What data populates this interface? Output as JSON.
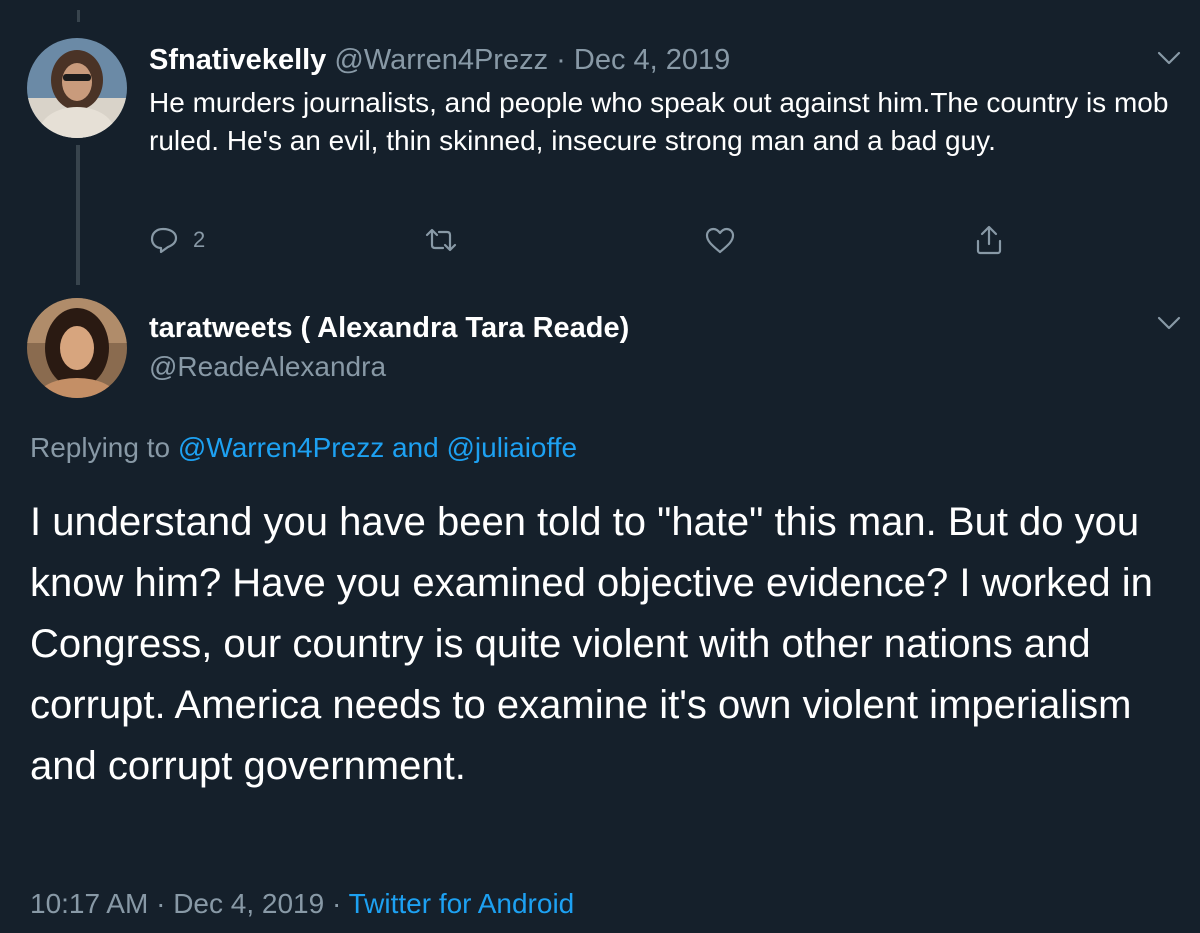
{
  "tweet1": {
    "display_name": "Sfnativekelly",
    "handle": "@Warren4Prezz",
    "separator": "·",
    "date": "Dec 4, 2019",
    "text": "He murders journalists, and people who speak out against him.The country is mob ruled.  He's an evil, thin skinned,  insecure strong man and a bad guy.",
    "reply_count": "2",
    "icons": [
      "reply-icon",
      "retweet-icon",
      "like-icon",
      "share-icon",
      "chevron-down-icon"
    ]
  },
  "tweet2": {
    "display_name": "taratweets ( Alexandra Tara Reade)",
    "handle": "@ReadeAlexandra",
    "replying_prefix": "Replying to",
    "replying_user1": "@Warren4Prezz",
    "replying_and": "and",
    "replying_user2": "@juliaioffe",
    "text": "I understand you have been told to \"hate\" this man. But do you know him? Have you examined objective evidence?  I worked in Congress, our country is quite violent with other nations and corrupt.  America needs to examine it's own violent imperialism and corrupt government.",
    "time": "10:17 AM",
    "separator": "·",
    "date": "Dec 4, 2019",
    "source": "Twitter for Android"
  },
  "colors": {
    "background": "#15202b",
    "text": "#ffffff",
    "muted": "#8899a6",
    "link": "#1da1f2",
    "thread_line": "#38444d"
  }
}
